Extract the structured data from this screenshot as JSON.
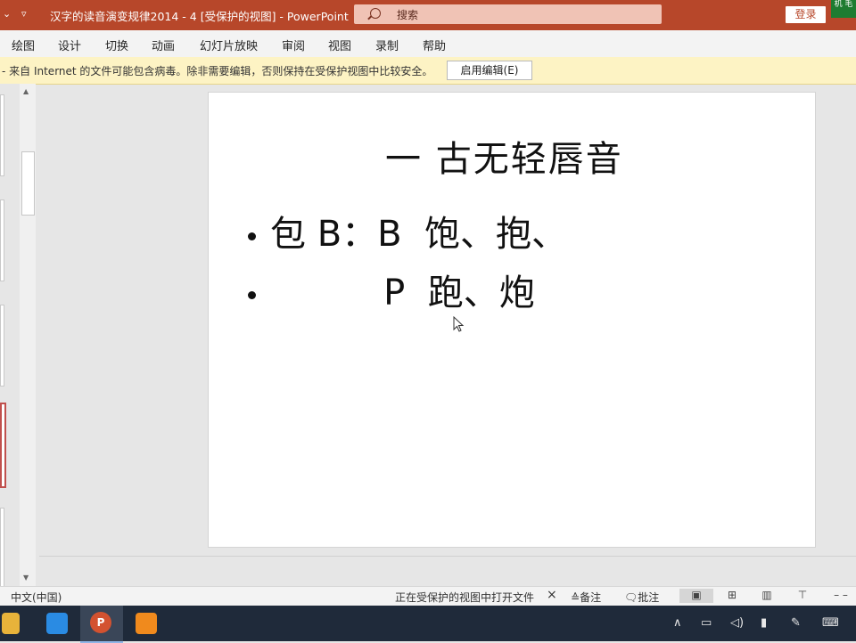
{
  "titlebar": {
    "quick_access_1": "⌄",
    "quick_access_2": "▿",
    "title": "汉字的读音演变规律2014 - 4 [受保护的视图]  -  PowerPoint",
    "search_placeholder": "搜索",
    "login_label": "登录",
    "tray_widget": "机 毛"
  },
  "ribbon": {
    "tabs": [
      "绘图",
      "设计",
      "切换",
      "动画",
      "幻灯片放映",
      "审阅",
      "视图",
      "录制",
      "帮助"
    ]
  },
  "message_bar": {
    "text": "- 来自 Internet 的文件可能包含病毒。除非需要编辑，否则保持在受保护视图中比较安全。",
    "enable_editing_label": "启用编辑(E)"
  },
  "slide": {
    "title": "一   古无轻唇音",
    "bullets": [
      "包 B：B  饱、抱、",
      "          P  跑、炮"
    ]
  },
  "statusbar": {
    "language": "中文(中国)",
    "status_text": "正在受保护的视图中打开文件",
    "close_symbol": "×",
    "notes_label": "备注",
    "comments_label": "批注"
  },
  "colors": {
    "titlebar_bg": "#b7472a",
    "message_bar_bg": "#fdf3c4",
    "taskbar_bg": "#1f2a3a"
  }
}
